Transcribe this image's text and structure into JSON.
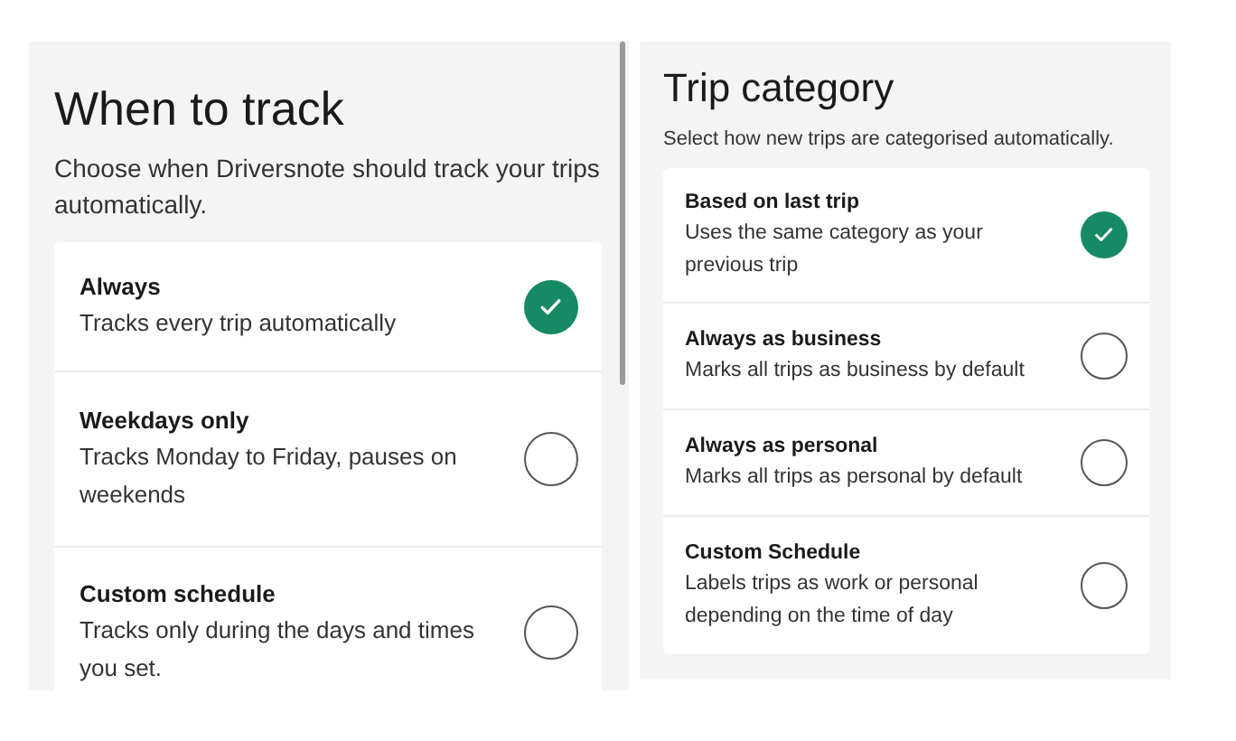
{
  "panels": [
    {
      "title": "When to track",
      "description": "Choose when Driversnote should track your trips automatically.",
      "options": [
        {
          "label": "Always",
          "description": "Tracks every trip automatically",
          "selected": true
        },
        {
          "label": "Weekdays only",
          "description": "Tracks Monday to Friday, pauses on weekends",
          "selected": false
        },
        {
          "label": "Custom schedule",
          "description": "Tracks only during the days and times you set.",
          "selected": false
        }
      ]
    },
    {
      "title": "Trip category",
      "description": "Select how new trips are categorised automatically.",
      "options": [
        {
          "label": "Based on last trip",
          "description": "Uses the same category as your previous trip",
          "selected": true
        },
        {
          "label": "Always as business",
          "description": "Marks all trips as business by default",
          "selected": false
        },
        {
          "label": "Always as personal",
          "description": "Marks all trips as personal by default",
          "selected": false
        },
        {
          "label": "Custom Schedule",
          "description": "Labels trips as work or personal depending on the time of day",
          "selected": false
        }
      ]
    }
  ]
}
